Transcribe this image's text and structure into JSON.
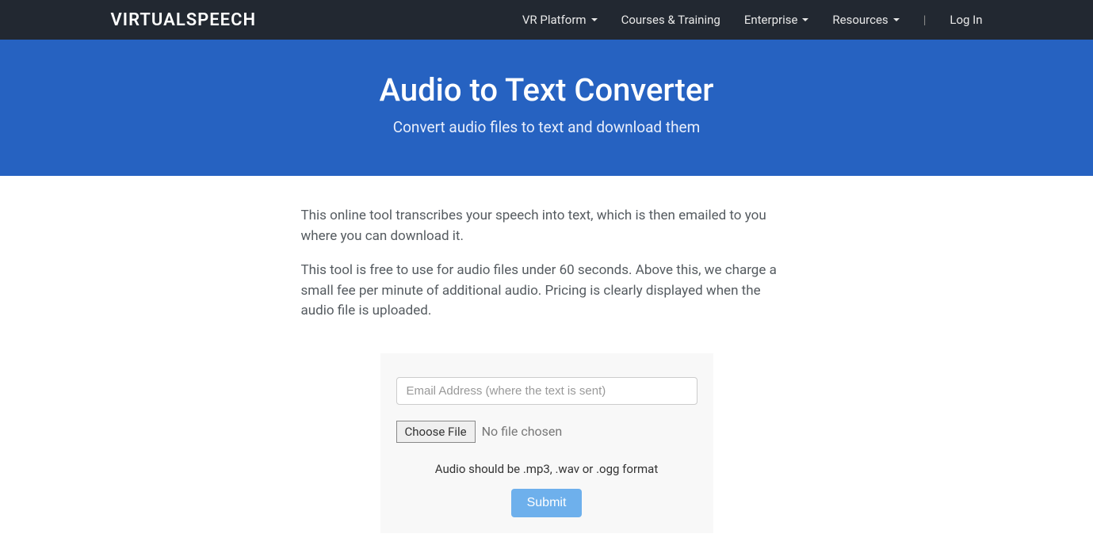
{
  "navbar": {
    "brand": "VIRTUALSPEECH",
    "items": {
      "vr_platform": "VR Platform",
      "courses": "Courses & Training",
      "enterprise": "Enterprise",
      "resources": "Resources",
      "divider": "|",
      "login": "Log In"
    }
  },
  "hero": {
    "title": "Audio to Text Converter",
    "subtitle": "Convert audio files to text and download them"
  },
  "content": {
    "para1": "This online tool transcribes your speech into text, which is then emailed to you where you can download it.",
    "para2": "This tool is free to use for audio files under 60 seconds. Above this, we charge a small fee per minute of additional audio. Pricing is clearly displayed when the audio file is uploaded."
  },
  "form": {
    "email_placeholder": "Email Address (where the text is sent)",
    "choose_file_label": "Choose File",
    "file_status": "No file chosen",
    "format_hint": "Audio should be .mp3, .wav or .ogg format",
    "submit_label": "Submit"
  }
}
